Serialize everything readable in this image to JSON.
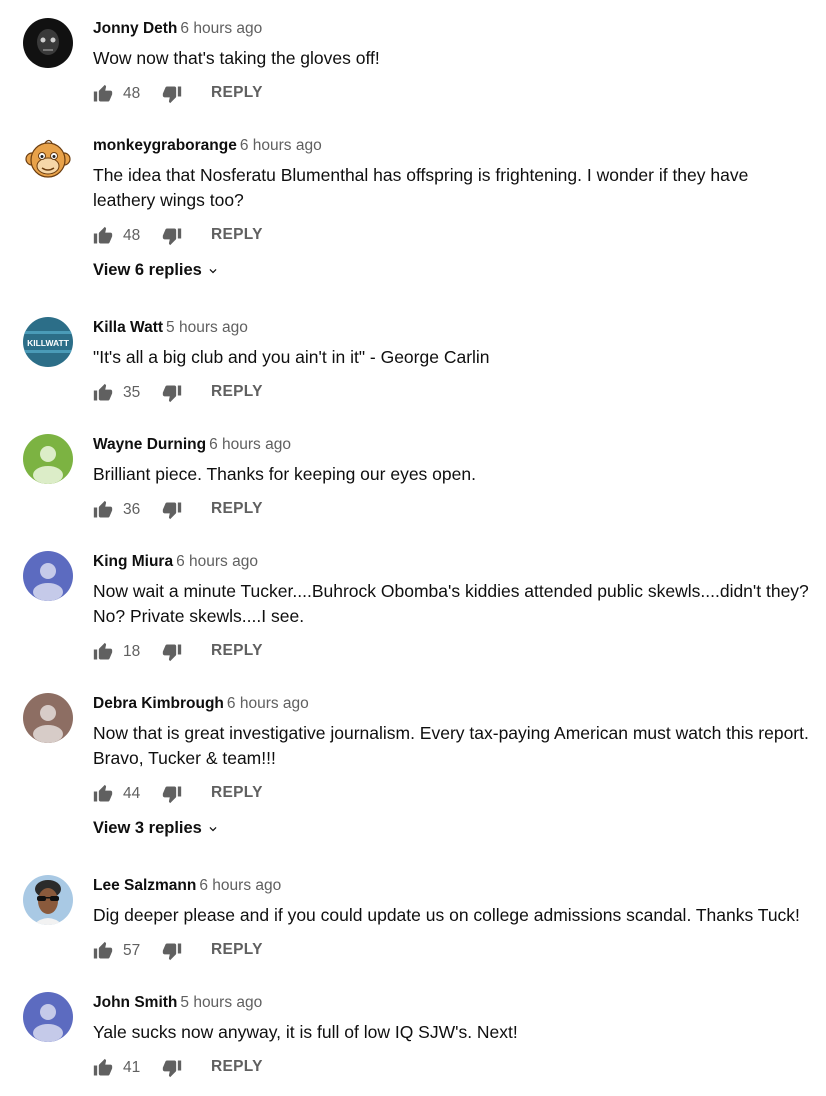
{
  "comments": [
    {
      "author": "Jonny Deth",
      "time": "6 hours ago",
      "text": "Wow now that's taking the gloves off!",
      "likes": "48",
      "reply_label": "REPLY",
      "avatar": "photo-dark-face",
      "avatar_color": "#1a1a1a"
    },
    {
      "author": "monkeygraborange",
      "time": "6 hours ago",
      "text": "The idea that Nosferatu Blumenthal has offspring is frightening. I wonder if they have leathery wings too?",
      "likes": "48",
      "reply_label": "REPLY",
      "view_replies": "View 6 replies",
      "avatar": "monkey-cartoon",
      "avatar_color": "#e8a24a"
    },
    {
      "author": "Killa Watt",
      "time": "5 hours ago",
      "text": "\"It's all a big club and you ain't in it\" - George Carlin",
      "likes": "35",
      "reply_label": "REPLY",
      "avatar": "logo",
      "avatar_text": "KILLWATT",
      "avatar_color": "#2c6e88"
    },
    {
      "author": "Wayne Durning",
      "time": "6 hours ago",
      "text": "Brilliant piece. Thanks for keeping our eyes open.",
      "likes": "36",
      "reply_label": "REPLY",
      "avatar": "default-person",
      "avatar_color": "#7cb342"
    },
    {
      "author": "King Miura",
      "time": "6 hours ago",
      "text": "Now wait a minute Tucker....Buhrock Obomba's kiddies attended public skewls....didn't they? No?  Private skewls....I see.",
      "likes": "18",
      "reply_label": "REPLY",
      "avatar": "default-person",
      "avatar_color": "#5c6bc0"
    },
    {
      "author": "Debra Kimbrough",
      "time": "6 hours ago",
      "text": "Now that is great investigative journalism. Every tax-paying American must watch this report. Bravo, Tucker & team!!!",
      "likes": "44",
      "reply_label": "REPLY",
      "view_replies": "View 3 replies",
      "avatar": "default-person",
      "avatar_color": "#8d6e63"
    },
    {
      "author": "Lee Salzmann",
      "time": "6 hours ago",
      "text": "Dig deeper please and if you could update us on college admissions scandal. Thanks Tuck!",
      "likes": "57",
      "reply_label": "REPLY",
      "avatar": "photo-sunglasses",
      "avatar_color": "#a9c9e4"
    },
    {
      "author": "John Smith",
      "time": "5 hours ago",
      "text": "Yale sucks now anyway, it is full of low IQ SJW's. Next!",
      "likes": "41",
      "reply_label": "REPLY",
      "avatar": "default-person",
      "avatar_color": "#5c6bc0"
    }
  ]
}
